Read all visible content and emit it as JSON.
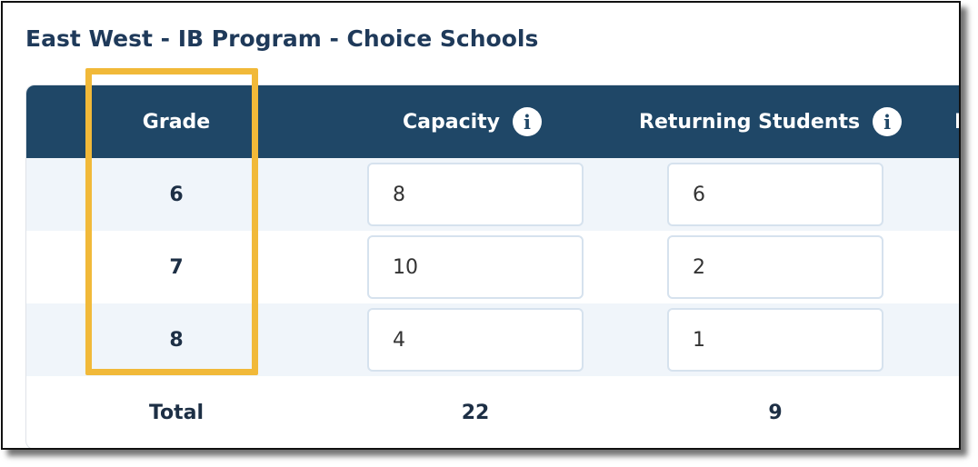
{
  "title": "East West - IB Program - Choice Schools",
  "table": {
    "headers": {
      "grade": "Grade",
      "capacity": "Capacity",
      "returning": "Returning Students",
      "next_partial": "L"
    },
    "info_glyph": "i",
    "rows": [
      {
        "grade": "6",
        "capacity": "8",
        "returning": "6"
      },
      {
        "grade": "7",
        "capacity": "10",
        "returning": "2"
      },
      {
        "grade": "8",
        "capacity": "4",
        "returning": "1"
      }
    ],
    "totals": {
      "label": "Total",
      "capacity": "22",
      "returning": "9"
    }
  },
  "colors": {
    "header_bg": "#1f4767",
    "title": "#1f3a5a",
    "highlight": "#f1b939",
    "row_shade": "#f0f5fa"
  },
  "icons": [
    "info-icon"
  ]
}
